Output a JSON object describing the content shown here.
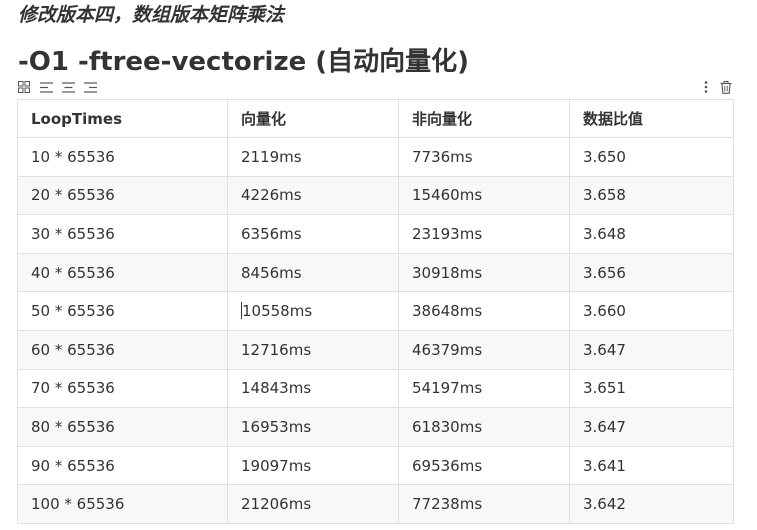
{
  "doc": {
    "subtitle": "修改版本四，数组版本矩阵乘法",
    "heading": "-O1 -ftree-vectorize (自动向量化)"
  },
  "toolbar": {
    "left_icons": [
      "grid-icon",
      "align-left-icon",
      "align-center-icon",
      "align-right-icon"
    ],
    "right_icons": [
      "more-vertical-icon",
      "trash-icon"
    ]
  },
  "table": {
    "headers": [
      "LoopTimes",
      "向量化",
      "非向量化",
      "数据比值"
    ],
    "rows": [
      [
        "10 * 65536",
        "2119ms",
        "7736ms",
        "3.650"
      ],
      [
        "20 * 65536",
        "4226ms",
        "15460ms",
        "3.658"
      ],
      [
        "30 * 65536",
        "6356ms",
        "23193ms",
        "3.648"
      ],
      [
        "40 * 65536",
        "8456ms",
        "30918ms",
        "3.656"
      ],
      [
        "50 * 65536",
        "10558ms",
        "38648ms",
        "3.660"
      ],
      [
        "60 * 65536",
        "12716ms",
        "46379ms",
        "3.647"
      ],
      [
        "70 * 65536",
        "14843ms",
        "54197ms",
        "3.651"
      ],
      [
        "80 * 65536",
        "16953ms",
        "61830ms",
        "3.647"
      ],
      [
        "90 * 65536",
        "19097ms",
        "69536ms",
        "3.641"
      ],
      [
        "100 * 65536",
        "21206ms",
        "77238ms",
        "3.642"
      ]
    ]
  },
  "colors": {
    "text": "#333333",
    "border": "#dfe2e5",
    "stripe": "#f8f8f8"
  }
}
